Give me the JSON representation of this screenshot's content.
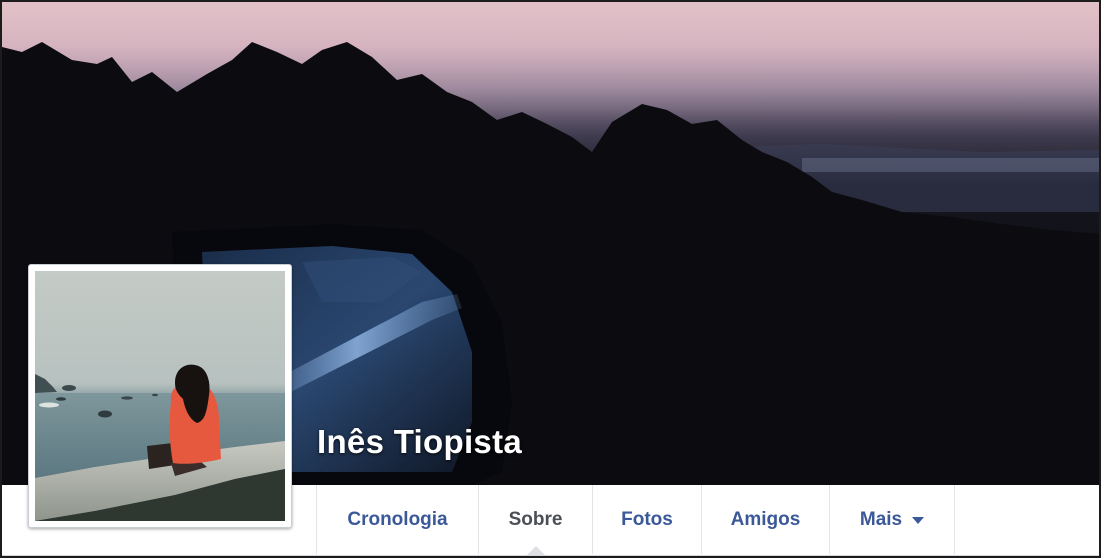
{
  "profile": {
    "name": "Inês Tiopista"
  },
  "nav": {
    "tabs": [
      {
        "label": "Cronologia",
        "active": false
      },
      {
        "label": "Sobre",
        "active": true
      },
      {
        "label": "Fotos",
        "active": false
      },
      {
        "label": "Amigos",
        "active": false
      },
      {
        "label": "Mais",
        "active": false,
        "icon": "caret-down-icon"
      }
    ]
  },
  "colors": {
    "link": "#3b5998",
    "active_tab": "#4b4f56",
    "name_text": "#ffffff"
  }
}
